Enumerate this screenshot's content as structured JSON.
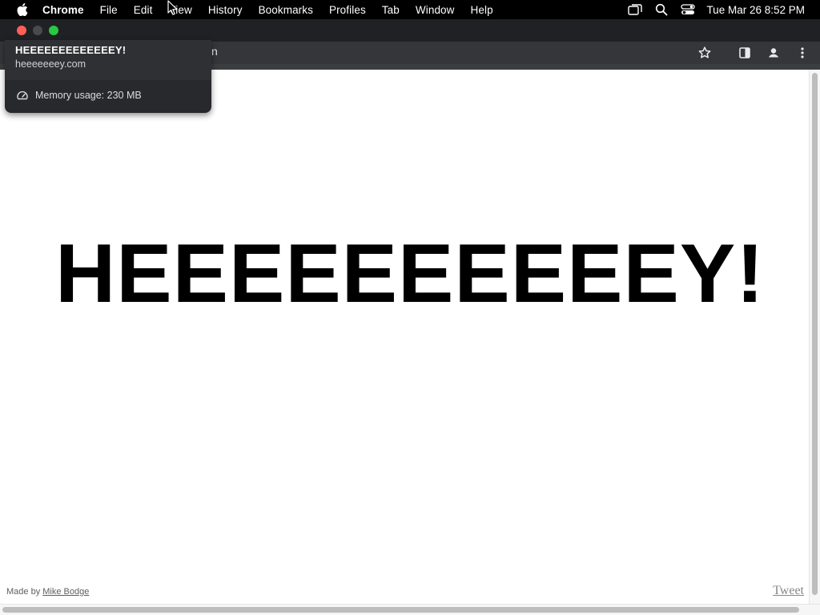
{
  "menubar": {
    "app_name": "Chrome",
    "items": [
      "File",
      "Edit",
      "View",
      "History",
      "Bookmarks",
      "Profiles",
      "Tab",
      "Window",
      "Help"
    ],
    "clock": "Tue Mar 26  8:52 PM",
    "status_icons": [
      "screen-mirroring-icon",
      "spotlight-search-icon",
      "control-center-icon"
    ]
  },
  "window": {
    "traffic_lights": [
      "close",
      "minimize",
      "zoom"
    ],
    "colors": {
      "close": "#ff5f57",
      "zoom": "#28c840",
      "titlebar": "#202124",
      "toolbar": "#35363a"
    }
  },
  "toolbar": {
    "omnibox_tail": "n",
    "icons": [
      "bookmark-star-icon",
      "side-panel-icon",
      "profile-icon",
      "menu-dots-icon"
    ]
  },
  "hovercard": {
    "title": "HEEEEEEEEEEEEEY!",
    "url": "heeeeeeey.com",
    "memory": "Memory usage: 230 MB"
  },
  "page": {
    "headline": "HEEEEEEEEEEY!",
    "made_by_prefix": "Made by ",
    "made_by_link": "Mike Bodge",
    "tweet": "Tweet"
  }
}
